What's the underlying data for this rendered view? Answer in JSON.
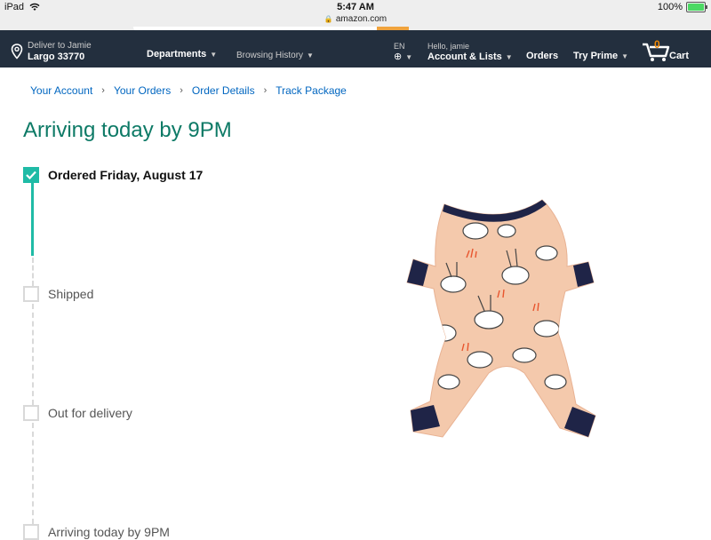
{
  "status_bar": {
    "device": "iPad",
    "time": "5:47 AM",
    "battery": "100%",
    "battery_level": 1.0
  },
  "browser": {
    "url": "amazon.com"
  },
  "nav": {
    "deliver_to": "Deliver to Jamie",
    "location": "Largo 33770",
    "departments": "Departments",
    "browsing_history": "Browsing History",
    "language": "EN",
    "greeting": "Hello, jamie",
    "account": "Account & Lists",
    "orders": "Orders",
    "prime": "Try Prime",
    "cart_count": "0",
    "cart": "Cart"
  },
  "breadcrumb": [
    "Your Account",
    "Your Orders",
    "Order Details",
    "Track Package"
  ],
  "title": "Arriving today by 9PM",
  "steps": [
    {
      "label": "Ordered Friday, August 17",
      "done": true
    },
    {
      "label": "Shipped",
      "done": false
    },
    {
      "label": "Out for delivery",
      "done": false
    },
    {
      "label": "Arriving today by 9PM",
      "done": false
    }
  ],
  "colors": {
    "nav_bg": "#232f3e",
    "accent_teal": "#1fbba6",
    "title_green": "#0d7a66",
    "link": "#0066c0",
    "cart_orange": "#f08804"
  },
  "product_image": "pet-pajama-bunny-print"
}
